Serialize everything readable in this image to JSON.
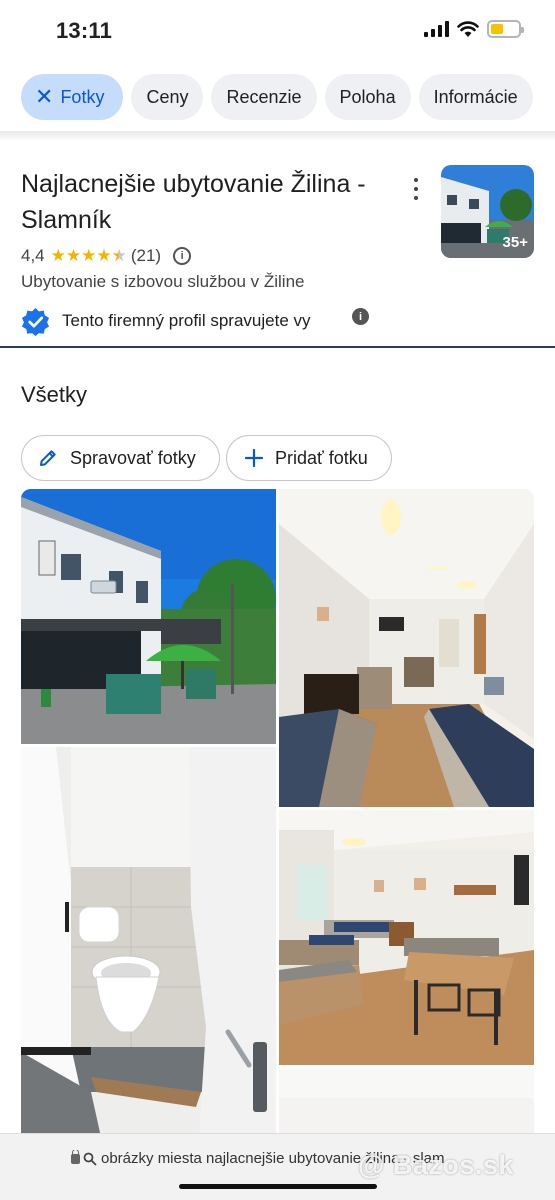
{
  "status_bar": {
    "time": "13:11",
    "battery_level": 0.45,
    "battery_color": "#f5c400"
  },
  "chips": [
    {
      "label": "Fotky",
      "active": true
    },
    {
      "label": "Ceny",
      "active": false
    },
    {
      "label": "Recenzie",
      "active": false
    },
    {
      "label": "Poloha",
      "active": false
    },
    {
      "label": "Informácie",
      "active": false
    }
  ],
  "place": {
    "title": "Najlacnejšie ubytovanie Žilina - Slamník",
    "rating": "4,4",
    "stars": 4.4,
    "review_count": "(21)",
    "category": "Ubytovanie s izbovou službou v Žiline",
    "verified_text": "Tento firemný profil spravujete vy",
    "photo_count": "35+"
  },
  "photos_section": {
    "title": "Všetky",
    "manage_label": "Spravovať fotky",
    "add_label": "Pridať fotku"
  },
  "url_bar": {
    "text": "obrázky miesta najlacnejšie ubytovanie žilina - slam"
  },
  "watermark": "@ Bazos.sk",
  "colors": {
    "accent": "#0b57d0",
    "chip_active_bg": "#c6dcfb",
    "star": "#f4b400",
    "verified": "#1a73e8"
  }
}
